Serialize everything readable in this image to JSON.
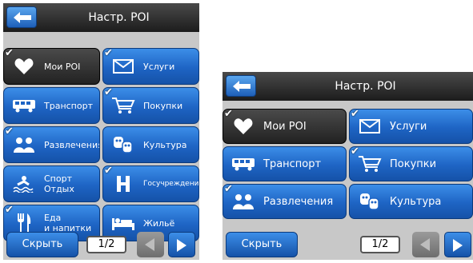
{
  "header": {
    "title": "Настр. POI"
  },
  "categories": [
    {
      "label": "Мои POI",
      "icon": "heart-icon",
      "checked": true,
      "selected": true
    },
    {
      "label": "Услуги",
      "icon": "envelope-icon",
      "checked": true
    },
    {
      "label": "Транспорт",
      "icon": "bus-icon"
    },
    {
      "label": "Покупки",
      "icon": "shopping-cart-icon",
      "checked": true
    },
    {
      "label": "Развлечения",
      "icon": "people-icon",
      "checked": true
    },
    {
      "label": "Культура",
      "icon": "theater-masks-icon"
    },
    {
      "label": "Спорт\nОтдых",
      "icon": "swimmer-icon"
    },
    {
      "label": "Госучреждения",
      "icon": "h-building-icon",
      "checked": true
    },
    {
      "label": "Еда\nи напитки",
      "icon": "fork-knife-icon",
      "checked": true
    },
    {
      "label": "Жильё",
      "icon": "bed-icon"
    }
  ],
  "footer": {
    "hide_label": "Скрыть",
    "page_indicator": "1/2"
  },
  "colors": {
    "button_blue": "#1e64c4",
    "selected_dark": "#2a2a2a",
    "header_dark": "#1c1c1c"
  }
}
